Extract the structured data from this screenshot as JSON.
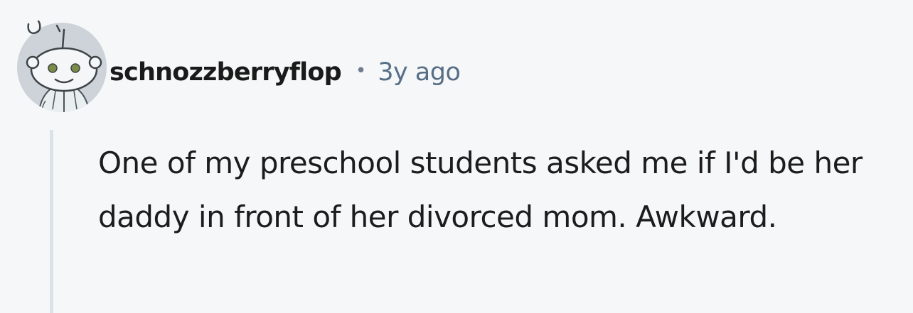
{
  "comment": {
    "avatar_icon": "snoo-avatar-icon",
    "author": "schnozzberryflop",
    "separator": "•",
    "timestamp": "3y ago",
    "body": "One of my preschool students asked me if I'd be her daddy in front of her divorced mom. Awkward."
  },
  "colors": {
    "background": "#f6f7f8",
    "username": "#1a1a1b",
    "timestamp": "#576f86",
    "body_text": "#1c1c1c",
    "thread_line": "#dbe3ea"
  }
}
